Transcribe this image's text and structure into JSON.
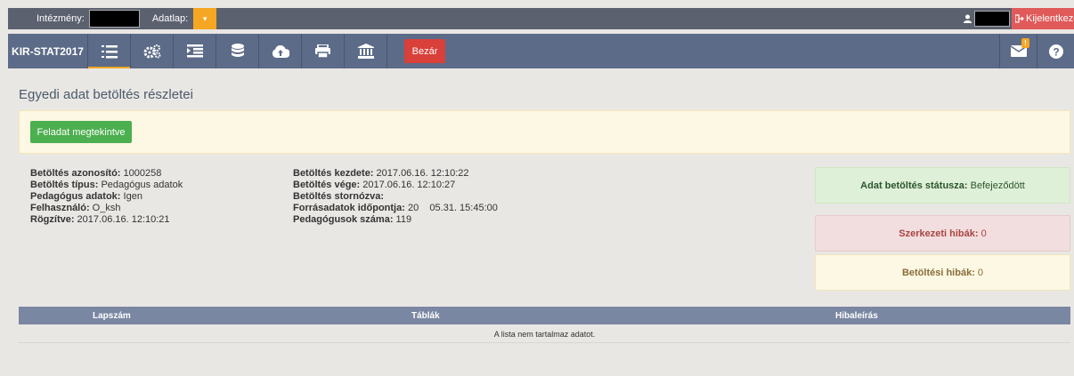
{
  "topbar": {
    "intezmeny_label": "Intézmény:",
    "adatlap_label": "Adatlap:",
    "logout_label": "Kijelentkezés"
  },
  "toolbar": {
    "brand": "KIR-STAT2017",
    "close_label": "Bezár",
    "badge": "!"
  },
  "page": {
    "title": "Egyedi adat betöltés részletei",
    "viewed_button": "Feladat megtekintve"
  },
  "details_left": [
    {
      "label": "Betöltés azonosító:",
      "value": " 1000258"
    },
    {
      "label": "Betöltés típus:",
      "value": " Pedagógus adatok"
    },
    {
      "label": "Pedagógus adatok:",
      "value": " Igen"
    },
    {
      "label": "Felhasználó:",
      "value": " O_ksh"
    },
    {
      "label": "Rögzítve:",
      "value": " 2017.06.16. 12:10:21"
    }
  ],
  "details_right": [
    {
      "label": "Betöltés kezdete:",
      "value": " 2017.06.16. 12:10:22"
    },
    {
      "label": "Betöltés vége:",
      "value": " 2017.06.16. 12:10:27"
    },
    {
      "label": "Betöltés stornózva:",
      "value": ""
    },
    {
      "label": "Forrásadatok időpontja:",
      "value": " 20    05.31. 15:45:00"
    },
    {
      "label": "Pedagógusok száma:",
      "value": " 119"
    }
  ],
  "status": {
    "status_label": "Adat betöltés státusza:",
    "status_value": " Befejeződött",
    "struct_label": "Szerkezeti hibák:",
    "struct_value": " 0",
    "load_label": "Betöltési hibák:",
    "load_value": " 0"
  },
  "table": {
    "columns": [
      "Lapszám",
      "Táblák",
      "Hibaleírás"
    ],
    "empty_text": "A lista nem tartalmaz adatot."
  },
  "colors": {
    "accent": "#f5a623",
    "toolbar": "#5c6b88",
    "danger": "#d9403a",
    "success": "#4caf50"
  }
}
